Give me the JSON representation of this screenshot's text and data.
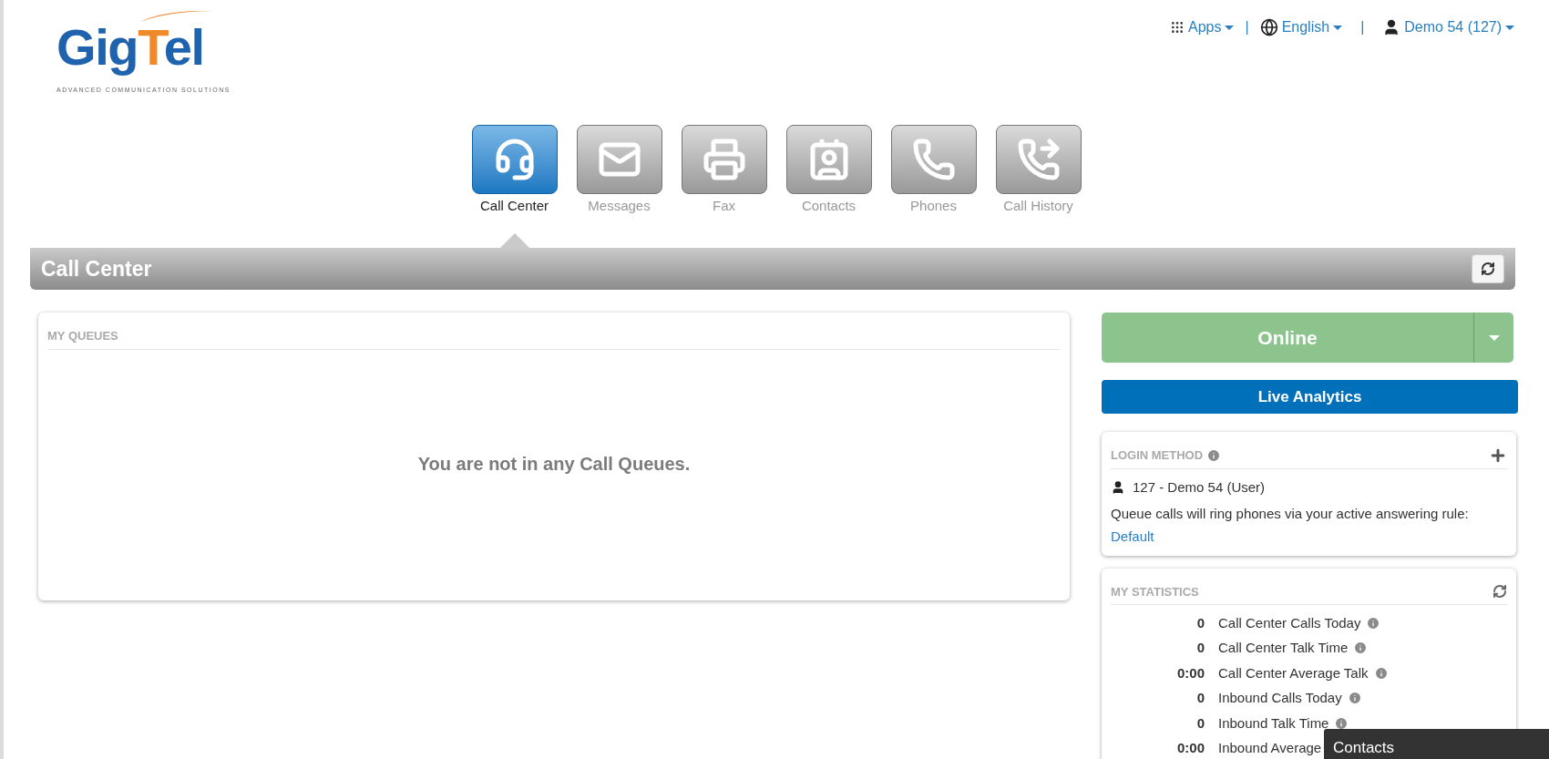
{
  "logo": {
    "wordmark": [
      {
        "text": "Gig",
        "color": "#1f62ad"
      },
      {
        "text": "T",
        "color": "#f0892a"
      },
      {
        "text": "el",
        "color": "#1f62ad"
      }
    ],
    "tagline": "ADVANCED COMMUNICATION SOLUTIONS"
  },
  "top_nav": {
    "separator": "|",
    "items": [
      {
        "kind": "apps",
        "label": "Apps"
      },
      {
        "kind": "language",
        "label": "English"
      },
      {
        "kind": "user",
        "label": "Demo 54 (127)"
      }
    ]
  },
  "tabs": [
    {
      "kind": "headset",
      "label": "Call Center",
      "selected": true
    },
    {
      "kind": "mail",
      "label": "Messages",
      "selected": false
    },
    {
      "kind": "fax",
      "label": "Fax",
      "selected": false
    },
    {
      "kind": "contact",
      "label": "Contacts",
      "selected": false
    },
    {
      "kind": "phone",
      "label": "Phones",
      "selected": false
    },
    {
      "kind": "history",
      "label": "Call History",
      "selected": false
    }
  ],
  "section": {
    "title": "Call Center"
  },
  "queues": {
    "title": "MY QUEUES",
    "empty_message": "You are not in any Call Queues."
  },
  "status_button": {
    "label": "Online"
  },
  "analytics_button": {
    "label": "Live Analytics"
  },
  "login_method": {
    "title": "LOGIN METHOD",
    "user": "127 - Demo 54 (User)",
    "note": "Queue calls will ring phones via your active answering rule:",
    "link": "Default"
  },
  "statistics": {
    "title": "MY STATISTICS",
    "rows": [
      {
        "value": "0",
        "label": "Call Center Calls Today"
      },
      {
        "value": "0",
        "label": "Call Center Talk Time"
      },
      {
        "value": "0:00",
        "label": "Call Center Average Talk"
      },
      {
        "value": "0",
        "label": "Inbound Calls Today"
      },
      {
        "value": "0",
        "label": "Inbound Talk Time"
      },
      {
        "value": "0:00",
        "label": "Inbound Average"
      }
    ]
  },
  "contacts_popup": {
    "title": "Contacts"
  }
}
